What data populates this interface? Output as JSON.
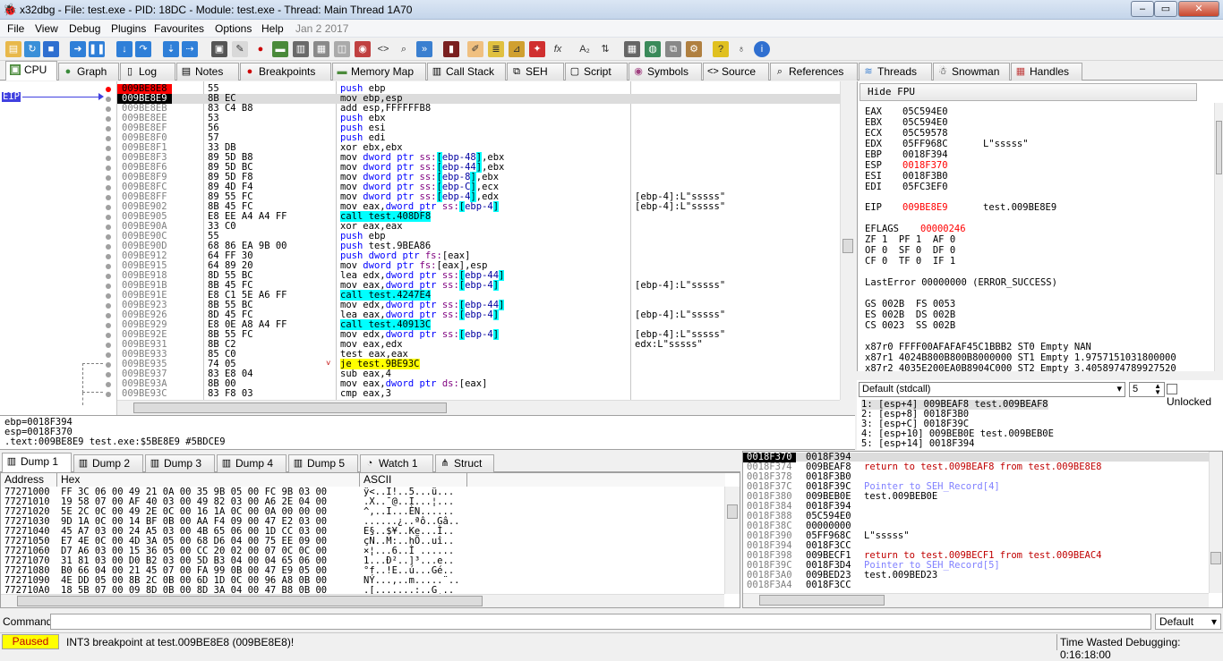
{
  "window": {
    "title": "x32dbg - File: test.exe - PID: 18DC - Module: test.exe - Thread: Main Thread 1A70",
    "app_icon": "bug-icon"
  },
  "menu": [
    "File",
    "View",
    "Debug",
    "Plugins",
    "Favourites",
    "Options",
    "Help",
    "Jan 2 2017"
  ],
  "tabs": [
    {
      "label": "CPU",
      "icon": "cpu-icon"
    },
    {
      "label": "Graph",
      "icon": "graph-icon"
    },
    {
      "label": "Log",
      "icon": "log-icon"
    },
    {
      "label": "Notes",
      "icon": "notes-icon"
    },
    {
      "label": "Breakpoints",
      "icon": "breakpoint-icon"
    },
    {
      "label": "Memory Map",
      "icon": "memory-icon"
    },
    {
      "label": "Call Stack",
      "icon": "callstack-icon"
    },
    {
      "label": "SEH",
      "icon": "seh-icon"
    },
    {
      "label": "Script",
      "icon": "script-icon"
    },
    {
      "label": "Symbols",
      "icon": "symbols-icon"
    },
    {
      "label": "Source",
      "icon": "source-icon"
    },
    {
      "label": "References",
      "icon": "references-icon"
    },
    {
      "label": "Threads",
      "icon": "threads-icon"
    },
    {
      "label": "Snowman",
      "icon": "snowman-icon"
    },
    {
      "label": "Handles",
      "icon": "handles-icon"
    }
  ],
  "eip_label": "EIP",
  "disasm": [
    {
      "addr": "009BE8E8",
      "bytes": "55",
      "ins": "push ebp",
      "cmt": ""
    },
    {
      "addr": "009BE8E9",
      "bytes": "8B EC",
      "ins": "mov ebp,esp",
      "cmt": ""
    },
    {
      "addr": "009BE8EB",
      "bytes": "83 C4 B8",
      "ins": "add esp,FFFFFFB8",
      "cmt": ""
    },
    {
      "addr": "009BE8EE",
      "bytes": "53",
      "ins": "push ebx",
      "cmt": ""
    },
    {
      "addr": "009BE8EF",
      "bytes": "56",
      "ins": "push esi",
      "cmt": ""
    },
    {
      "addr": "009BE8F0",
      "bytes": "57",
      "ins": "push edi",
      "cmt": ""
    },
    {
      "addr": "009BE8F1",
      "bytes": "33 DB",
      "ins": "xor ebx,ebx",
      "cmt": ""
    },
    {
      "addr": "009BE8F3",
      "bytes": "89 5D B8",
      "ins": "mov dword ptr ss:[ebp-48],ebx",
      "cmt": ""
    },
    {
      "addr": "009BE8F6",
      "bytes": "89 5D BC",
      "ins": "mov dword ptr ss:[ebp-44],ebx",
      "cmt": ""
    },
    {
      "addr": "009BE8F9",
      "bytes": "89 5D F8",
      "ins": "mov dword ptr ss:[ebp-8],ebx",
      "cmt": ""
    },
    {
      "addr": "009BE8FC",
      "bytes": "89 4D F4",
      "ins": "mov dword ptr ss:[ebp-C],ecx",
      "cmt": ""
    },
    {
      "addr": "009BE8FF",
      "bytes": "89 55 FC",
      "ins": "mov dword ptr ss:[ebp-4],edx",
      "cmt": "[ebp-4]:L\"sssss\""
    },
    {
      "addr": "009BE902",
      "bytes": "8B 45 FC",
      "ins": "mov eax,dword ptr ss:[ebp-4]",
      "cmt": "[ebp-4]:L\"sssss\""
    },
    {
      "addr": "009BE905",
      "bytes": "E8 EE A4 A4 FF",
      "ins": "call test.408DF8",
      "cmt": ""
    },
    {
      "addr": "009BE90A",
      "bytes": "33 C0",
      "ins": "xor eax,eax",
      "cmt": ""
    },
    {
      "addr": "009BE90C",
      "bytes": "55",
      "ins": "push ebp",
      "cmt": ""
    },
    {
      "addr": "009BE90D",
      "bytes": "68 86 EA 9B 00",
      "ins": "push test.9BEA86",
      "cmt": ""
    },
    {
      "addr": "009BE912",
      "bytes": "64 FF 30",
      "ins": "push dword ptr fs:[eax]",
      "cmt": ""
    },
    {
      "addr": "009BE915",
      "bytes": "64 89 20",
      "ins": "mov dword ptr fs:[eax],esp",
      "cmt": ""
    },
    {
      "addr": "009BE918",
      "bytes": "8D 55 BC",
      "ins": "lea edx,dword ptr ss:[ebp-44]",
      "cmt": ""
    },
    {
      "addr": "009BE91B",
      "bytes": "8B 45 FC",
      "ins": "mov eax,dword ptr ss:[ebp-4]",
      "cmt": "[ebp-4]:L\"sssss\""
    },
    {
      "addr": "009BE91E",
      "bytes": "E8 C1 5E A6 FF",
      "ins": "call test.4247E4",
      "cmt": ""
    },
    {
      "addr": "009BE923",
      "bytes": "8B 55 BC",
      "ins": "mov edx,dword ptr ss:[ebp-44]",
      "cmt": ""
    },
    {
      "addr": "009BE926",
      "bytes": "8D 45 FC",
      "ins": "lea eax,dword ptr ss:[ebp-4]",
      "cmt": "[ebp-4]:L\"sssss\""
    },
    {
      "addr": "009BE929",
      "bytes": "E8 0E A8 A4 FF",
      "ins": "call test.40913C",
      "cmt": ""
    },
    {
      "addr": "009BE92E",
      "bytes": "8B 55 FC",
      "ins": "mov edx,dword ptr ss:[ebp-4]",
      "cmt": "[ebp-4]:L\"sssss\""
    },
    {
      "addr": "009BE931",
      "bytes": "8B C2",
      "ins": "mov eax,edx",
      "cmt": "edx:L\"sssss\""
    },
    {
      "addr": "009BE933",
      "bytes": "85 C0",
      "ins": "test eax,eax",
      "cmt": ""
    },
    {
      "addr": "009BE935",
      "bytes": "74 05",
      "ins": "je test.9BE93C",
      "cmt": ""
    },
    {
      "addr": "009BE937",
      "bytes": "83 E8 04",
      "ins": "sub eax,4",
      "cmt": ""
    },
    {
      "addr": "009BE93A",
      "bytes": "8B 00",
      "ins": "mov eax,dword ptr ds:[eax]",
      "cmt": ""
    },
    {
      "addr": "009BE93C",
      "bytes": "83 F8 03",
      "ins": "cmp eax,3",
      "cmt": ""
    }
  ],
  "info": [
    "ebp=0018F394",
    "esp=0018F370",
    ".text:009BE8E9 test.exe:$5BE8E9 #5BDCE9"
  ],
  "hide_fpu": "Hide FPU",
  "registers": [
    {
      "name": "EAX",
      "val": "05C594E0",
      "extra": "",
      "changed": false
    },
    {
      "name": "EBX",
      "val": "05C594E0",
      "extra": "",
      "changed": false
    },
    {
      "name": "ECX",
      "val": "05C59578",
      "extra": "",
      "changed": false
    },
    {
      "name": "EDX",
      "val": "05FF968C",
      "extra": "L\"sssss\"",
      "changed": false
    },
    {
      "name": "EBP",
      "val": "0018F394",
      "extra": "",
      "changed": false
    },
    {
      "name": "ESP",
      "val": "0018F370",
      "extra": "",
      "changed": true
    },
    {
      "name": "ESI",
      "val": "0018F3B0",
      "extra": "",
      "changed": false
    },
    {
      "name": "EDI",
      "val": "05FC3EF0",
      "extra": "",
      "changed": false
    }
  ],
  "eip": {
    "name": "EIP",
    "val": "009BE8E9",
    "extra": "test.009BE8E9"
  },
  "eflags": {
    "name": "EFLAGS",
    "val": "00000246"
  },
  "flags_lines": [
    "ZF 1  PF 1  AF 0",
    "OF 0  SF 0  DF 0",
    "CF 0  TF 0  IF 1"
  ],
  "lasterror": "LastError 00000000 (ERROR_SUCCESS)",
  "segments": [
    "GS 002B  FS 0053",
    "ES 002B  DS 002B",
    "CS 0023  SS 002B"
  ],
  "fpu": [
    "x87r0 FFFF00AFAFAF45C1BBB2 ST0 Empty NAN",
    "x87r1 4024B800B800B8000000 ST1 Empty 1.9757151031800000",
    "x87r2 4035E200EA0B8904C000 ST2 Empty 3.4058974789927520"
  ],
  "callconv": "Default (stdcall)",
  "argcount": "5",
  "unlocked": "Unlocked",
  "args": [
    "1: [esp+4] 009BEAF8 test.009BEAF8",
    "2: [esp+8] 0018F3B0",
    "3: [esp+C] 0018F39C",
    "4: [esp+10] 009BEB0E test.009BEB0E",
    "5: [esp+14] 0018F394"
  ],
  "dump_tabs": [
    "Dump 1",
    "Dump 2",
    "Dump 3",
    "Dump 4",
    "Dump 5",
    "Watch 1",
    "Struct"
  ],
  "dump_headers": {
    "address": "Address",
    "hex": "Hex",
    "ascii": "ASCII"
  },
  "dump_rows": [
    {
      "addr": "77271000",
      "hex": "FF 3C 06 00 49 21 0A 00 35 9B 05 00 FC 9B 03 00",
      "ascii": "ÿ<..I!..5...ü..."
    },
    {
      "addr": "77271010",
      "hex": "19 58 07 00 AF 40 03 00 49 82 03 00 A6 2E 04 00",
      "ascii": ".X..¯@..I...¦..."
    },
    {
      "addr": "77271020",
      "hex": "5E 2C 0C 00 49 2E 0C 00 16 1A 0C 00 0A 00 00 00",
      "ascii": "^,..I...ÈN......"
    },
    {
      "addr": "77271030",
      "hex": "9D 1A 0C 00 14 BF 0B 00 AA F4 09 00 47 E2 03 00",
      "ascii": "......¿..ªô..Gâ.."
    },
    {
      "addr": "77271040",
      "hex": "45 A7 03 00 24 A5 03 00 4B 65 06 00 1D CC 03 00",
      "ascii": "E§..$¥..Ke...Ì.."
    },
    {
      "addr": "77271050",
      "hex": "E7 4E 0C 00 4D 3A 05 00 68 D6 04 00 75 EE 09 00",
      "ascii": "çN..M:..hÖ..uî.."
    },
    {
      "addr": "77271060",
      "hex": "D7 A6 03 00 15 36 05 00 CC 20 02 00 07 0C 0C 00",
      "ascii": "×¦...6..Ì ......"
    },
    {
      "addr": "77271070",
      "hex": "31 81 03 00 D0 B2 03 00 5D B3 04 00 04 65 06 00",
      "ascii": "1...Ð²..]³...e.."
    },
    {
      "addr": "77271080",
      "hex": "B0 66 04 00 21 45 07 00 FA 99 0B 00 47 E9 05 00",
      "ascii": "°f..!E..ú...Gé.."
    },
    {
      "addr": "77271090",
      "hex": "4E DD 05 00 8B 2C 0B 00 6D 1D 0C 00 96 A8 0B 00",
      "ascii": "NÝ...,..m.....¨.."
    },
    {
      "addr": "772710A0",
      "hex": "18 5B 07 00 09 8D 0B 00 8D 3A 04 00 47 B8 0B 00",
      "ascii": ".[.......:..G¸.."
    }
  ],
  "stack_rows": [
    {
      "addr": "0018F370",
      "val": "0018F394",
      "cmt": "",
      "kind": "current"
    },
    {
      "addr": "0018F374",
      "val": "009BEAF8",
      "cmt": "return to test.009BEAF8 from test.009BE8E8",
      "kind": "ret"
    },
    {
      "addr": "0018F378",
      "val": "0018F3B0",
      "cmt": "",
      "kind": ""
    },
    {
      "addr": "0018F37C",
      "val": "0018F39C",
      "cmt": "Pointer to SEH_Record[4]",
      "kind": "seh"
    },
    {
      "addr": "0018F380",
      "val": "009BEB0E",
      "cmt": "test.009BEB0E",
      "kind": ""
    },
    {
      "addr": "0018F384",
      "val": "0018F394",
      "cmt": "",
      "kind": ""
    },
    {
      "addr": "0018F388",
      "val": "05C594E0",
      "cmt": "",
      "kind": ""
    },
    {
      "addr": "0018F38C",
      "val": "00000000",
      "cmt": "",
      "kind": ""
    },
    {
      "addr": "0018F390",
      "val": "05FF968C",
      "cmt": "L\"sssss\"",
      "kind": ""
    },
    {
      "addr": "0018F394",
      "val": "0018F3CC",
      "cmt": "",
      "kind": ""
    },
    {
      "addr": "0018F398",
      "val": "009BECF1",
      "cmt": "return to test.009BECF1 from test.009BEAC4",
      "kind": "ret"
    },
    {
      "addr": "0018F39C",
      "val": "0018F3D4",
      "cmt": "Pointer to SEH_Record[5]",
      "kind": "seh"
    },
    {
      "addr": "0018F3A0",
      "val": "009BED23",
      "cmt": "test.009BED23",
      "kind": ""
    },
    {
      "addr": "0018F3A4",
      "val": "0018F3CC",
      "cmt": "",
      "kind": ""
    }
  ],
  "command_label": "Command:",
  "command_mode": "Default",
  "status": {
    "state": "Paused",
    "message": "INT3 breakpoint at test.009BE8E8 (009BE8E8)!",
    "time": "Time Wasted Debugging: 0:16:18:00"
  }
}
